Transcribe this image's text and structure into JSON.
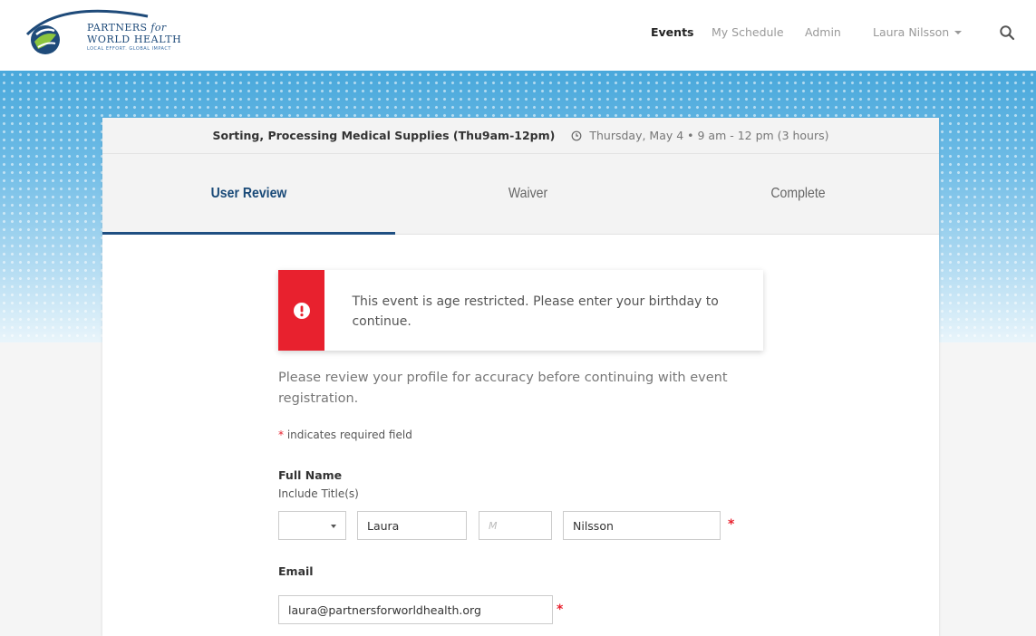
{
  "brand": {
    "line1_main": "PARTNERS",
    "line1_for": "for",
    "line2": "WORLD HEALTH",
    "tagline": "LOCAL EFFORT. GLOBAL IMPACT",
    "color": "#1f4b7a"
  },
  "nav": {
    "events": "Events",
    "my_schedule": "My Schedule",
    "admin": "Admin",
    "user": "Laura Nilsson",
    "search_icon": "search-icon"
  },
  "event": {
    "title": "Sorting, Processing Medical Supplies (Thu9am-12pm)",
    "date": "Thursday, May 4 • 9 am - 12 pm (3 hours)"
  },
  "tabs": {
    "user_review": "User Review",
    "waiver": "Waiver",
    "complete": "Complete",
    "active": "User Review"
  },
  "alert": {
    "message": "This event is age restricted. Please enter your birthday to continue.",
    "color": "#e8212e"
  },
  "form": {
    "intro": "Please review your profile for accuracy before continuing with event registration.",
    "required_star": "*",
    "required_note": "indicates required field",
    "full_name_label": "Full Name",
    "full_name_sublabel": "Include Title(s)",
    "title_value": "",
    "first_name": "Laura",
    "middle_placeholder": "M",
    "last_name": "Nilsson",
    "email_label": "Email",
    "email_value": "laura@partnersforworldhealth.org"
  }
}
